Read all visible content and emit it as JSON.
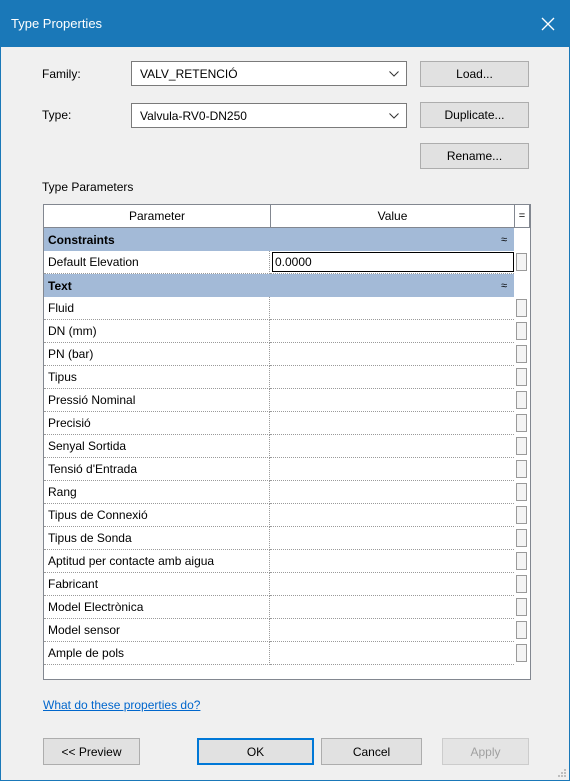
{
  "window": {
    "title": "Type Properties",
    "close": "✕"
  },
  "family": {
    "label": "Family:",
    "value": "VALV_RETENCIÓ"
  },
  "type": {
    "label": "Type:",
    "value": "Valvula-RV0-DN250"
  },
  "buttons": {
    "load": "Load...",
    "duplicate": "Duplicate...",
    "rename": "Rename...",
    "preview": "<< Preview",
    "ok": "OK",
    "cancel": "Cancel",
    "apply": "Apply"
  },
  "section_label": "Type Parameters",
  "grid": {
    "header_parameter": "Parameter",
    "header_value": "Value",
    "header_toggle": "=",
    "group_constraints": "Constraints",
    "group_text": "Text",
    "collapse_glyph": "≈",
    "default_elevation_label": "Default Elevation",
    "default_elevation_value": "0.0000",
    "text_params": [
      "Fluid",
      "DN (mm)",
      "PN (bar)",
      "Tipus",
      "Pressió Nominal",
      "Precisió",
      "Senyal Sortida",
      "Tensió d'Entrada",
      "Rang",
      "Tipus de Connexió",
      "Tipus de Sonda",
      "Aptitud per contacte amb aigua",
      "Fabricant",
      "Model Electrònica",
      "Model sensor",
      "Ample de pols"
    ]
  },
  "help_link": "What do these properties do?"
}
